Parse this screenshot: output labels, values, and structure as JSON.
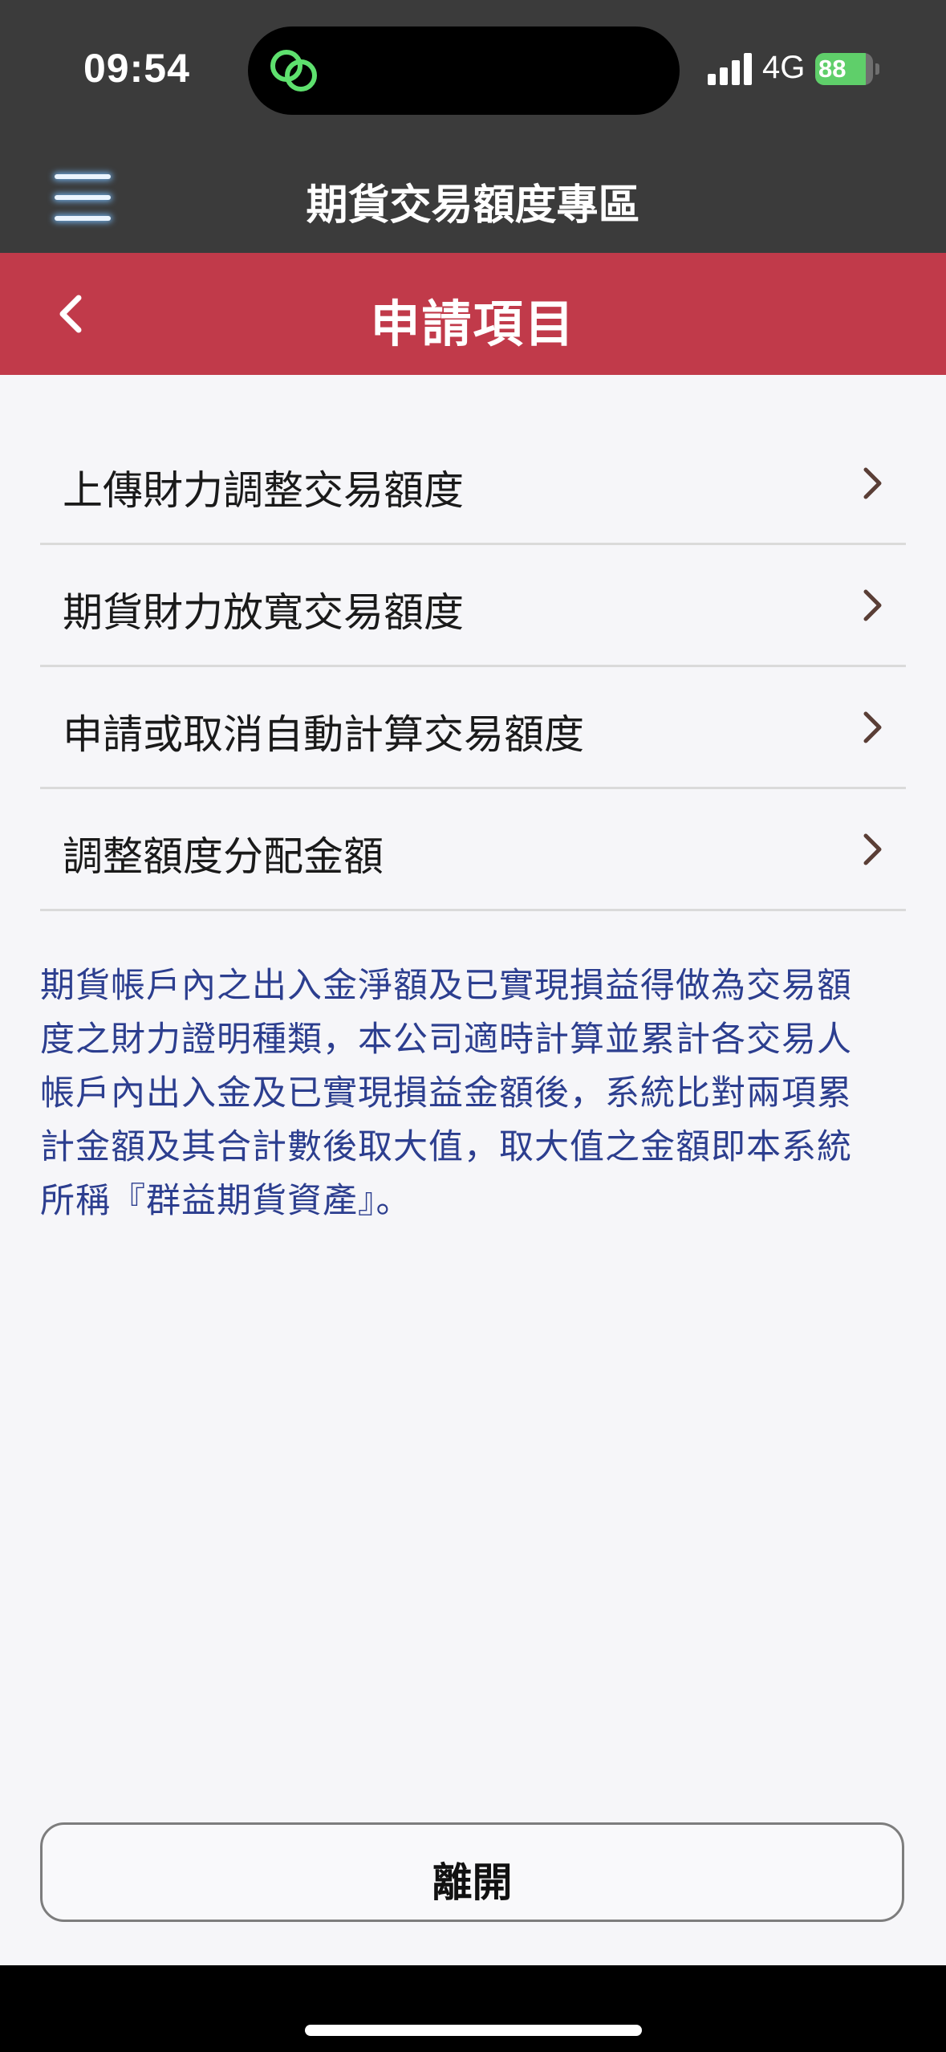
{
  "status_bar": {
    "time": "09:54",
    "network": "4G",
    "battery": "88",
    "battery_level": 0.88,
    "icons": [
      "link-icon",
      "signal-icon",
      "battery-icon"
    ]
  },
  "header": {
    "title": "期貨交易額度專區",
    "menu_icon": "hamburger-menu-icon"
  },
  "sub_header": {
    "title": "申請項目",
    "back_icon": "chevron-left-icon",
    "color": "#c13a4a"
  },
  "menu": {
    "items": [
      {
        "label": "上傳財力調整交易額度"
      },
      {
        "label": "期貨財力放寬交易額度"
      },
      {
        "label": "申請或取消自動計算交易額度"
      },
      {
        "label": "調整額度分配金額"
      }
    ],
    "chevron_icon": "chevron-right-icon"
  },
  "description": {
    "lines": [
      "期貨帳戶內之出入金淨額及已實現損益得做為交易額",
      "度之財力證明種類，本公司適時計算並累計各交易人",
      "帳戶內出入金及已實現損益金額後，系統比對兩項累",
      "計金額及其合計數後取大值，取大值之金額即本系統",
      "所稱『群益期貨資產』。"
    ],
    "color": "#2c3e8f"
  },
  "footer": {
    "leave_label": "離開"
  }
}
